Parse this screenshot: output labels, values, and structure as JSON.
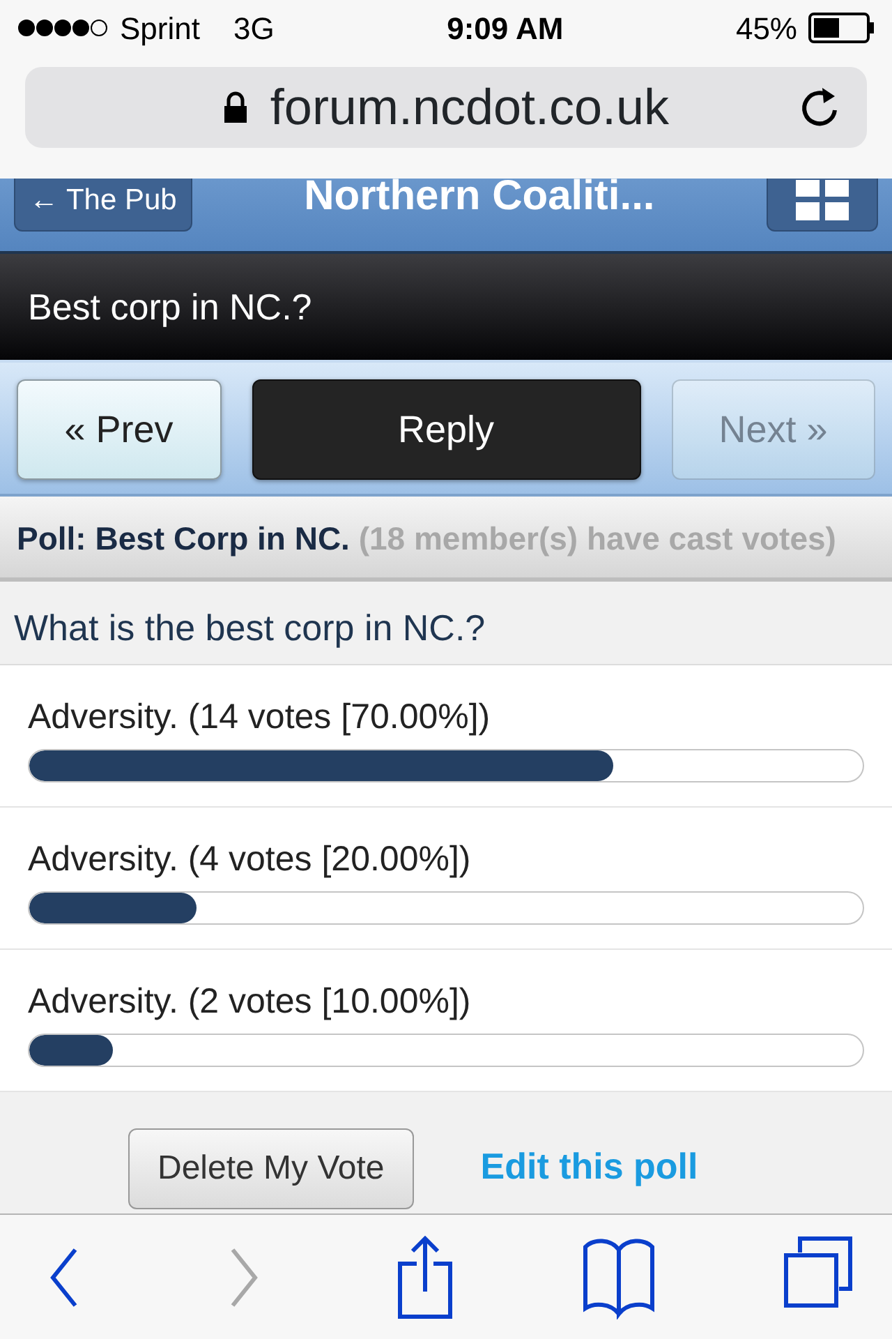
{
  "status_bar": {
    "carrier": "Sprint",
    "network": "3G",
    "time": "9:09 AM",
    "battery": "45%"
  },
  "address_bar": {
    "url": "forum.ncdot.co.uk"
  },
  "header": {
    "back_label": "← The Pub",
    "title": "Northern Coaliti..."
  },
  "thread_title": "Best corp in NC.?",
  "nav_buttons": [
    {
      "label": "« Prev",
      "kind": "light",
      "disabled": false
    },
    {
      "label": "Reply",
      "kind": "dark",
      "disabled": false
    },
    {
      "label": "Next »",
      "kind": "light",
      "disabled": true
    }
  ],
  "poll": {
    "title": "Poll: Best Corp in NC.",
    "votes_note": "(18 member(s) have cast votes)",
    "question": "What is the best corp in NC.?",
    "options": [
      {
        "label": "Adversity. (14 votes [70.00%])",
        "level": 0.7
      },
      {
        "label": "Adversity. (4 votes [20.00%])",
        "level": 0.2
      },
      {
        "label": "Adversity. (2 votes [10.00%])",
        "level": 0.1
      }
    ],
    "delete_button": "Delete My Vote",
    "edit_link": "Edit this poll"
  },
  "toolbar": [
    {
      "kind": "back",
      "disabled": false
    },
    {
      "kind": "forward",
      "disabled": true
    },
    {
      "kind": "share",
      "disabled": false
    },
    {
      "kind": "bookmarks",
      "disabled": false
    },
    {
      "kind": "tabs",
      "disabled": false
    }
  ]
}
